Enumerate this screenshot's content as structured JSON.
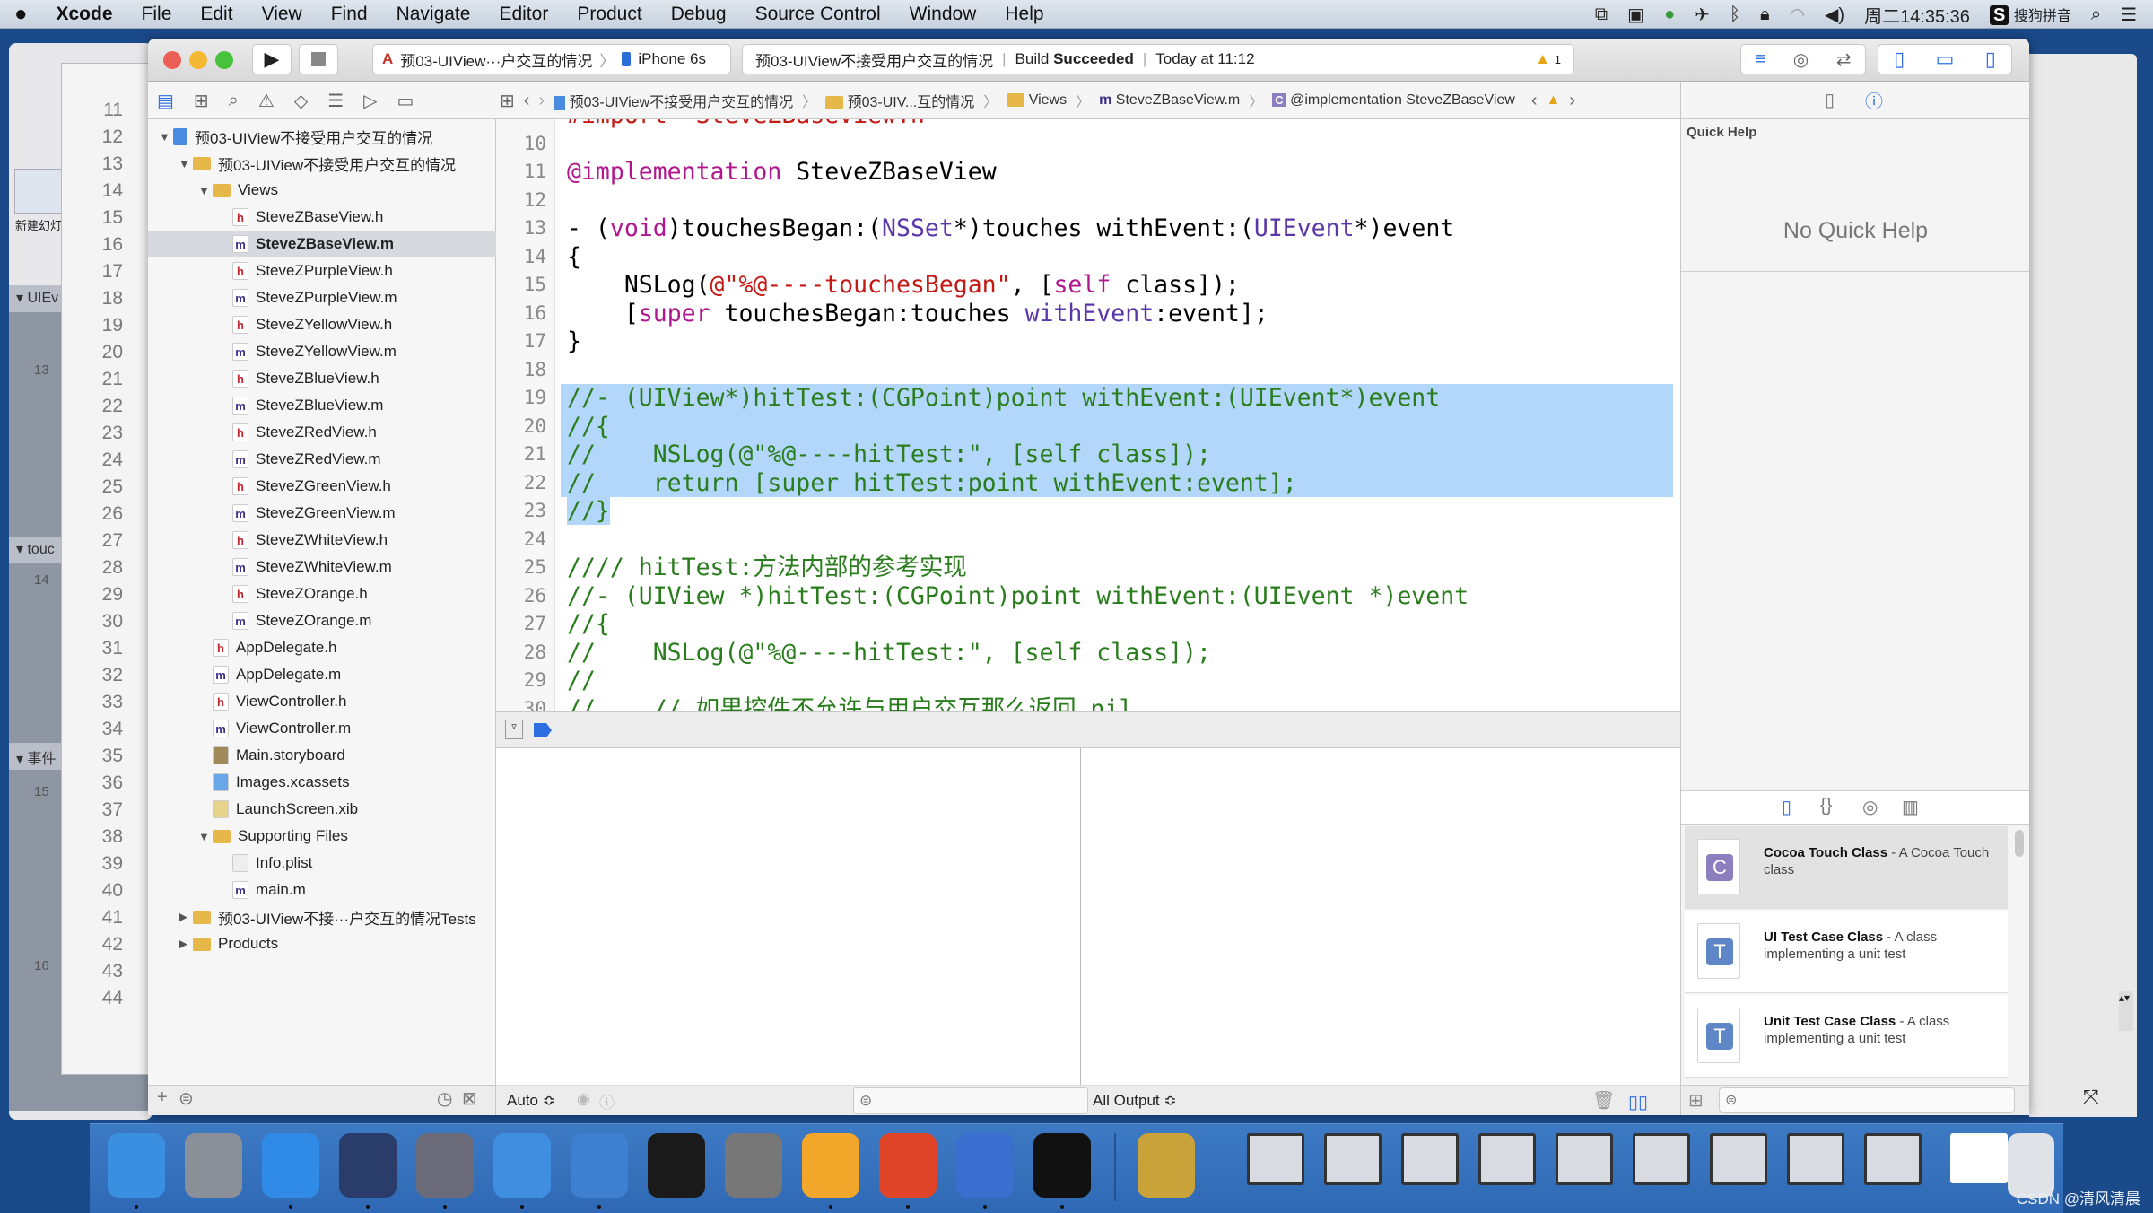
{
  "menubar": {
    "app": "Xcode",
    "items": [
      "File",
      "Edit",
      "View",
      "Find",
      "Navigate",
      "Editor",
      "Product",
      "Debug",
      "Source Control",
      "Window",
      "Help"
    ],
    "clock": "周二14:35:36",
    "input_method": "搜狗拼音"
  },
  "background_app": {
    "button": "新建幻灯片",
    "sections": [
      "UIEv",
      "touc",
      "事件"
    ],
    "slide_numbers": [
      "13",
      "14",
      "15",
      "16"
    ]
  },
  "back_window": {
    "line_numbers": [
      "11",
      "12",
      "13",
      "14",
      "15",
      "16",
      "17",
      "18",
      "19",
      "20",
      "21",
      "22",
      "23",
      "24",
      "25",
      "26",
      "27",
      "28",
      "29",
      "30",
      "31",
      "32",
      "33",
      "34",
      "35",
      "36",
      "37",
      "38",
      "39",
      "40",
      "41",
      "42",
      "43",
      "44"
    ]
  },
  "toolbar": {
    "scheme": "预03-UIView···户交互的情况",
    "device": "iPhone 6s",
    "status_project": "预03-UIView不接受用户交互的情况",
    "status_prefix": "Build",
    "status_result": "Succeeded",
    "status_time": "Today at 11:12",
    "warning_count": "1"
  },
  "jumpbar": {
    "items": [
      "预03-UIView不接受用户交互的情况",
      "预03-UIV...互的情况",
      "Views",
      "SteveZBaseView.m",
      "@implementation SteveZBaseView"
    ]
  },
  "navigator": {
    "items": [
      {
        "label": "预03-UIView不接受用户交互的情况",
        "kind": "project",
        "depth": 0,
        "open": true
      },
      {
        "label": "预03-UIView不接受用户交互的情况",
        "kind": "folder",
        "depth": 1,
        "open": true
      },
      {
        "label": "Views",
        "kind": "folder",
        "depth": 2,
        "open": true
      },
      {
        "label": "SteveZBaseView.h",
        "kind": "h",
        "depth": 3
      },
      {
        "label": "SteveZBaseView.m",
        "kind": "m",
        "depth": 3,
        "selected": true
      },
      {
        "label": "SteveZPurpleView.h",
        "kind": "h",
        "depth": 3
      },
      {
        "label": "SteveZPurpleView.m",
        "kind": "m",
        "depth": 3
      },
      {
        "label": "SteveZYellowView.h",
        "kind": "h",
        "depth": 3
      },
      {
        "label": "SteveZYellowView.m",
        "kind": "m",
        "depth": 3
      },
      {
        "label": "SteveZBlueView.h",
        "kind": "h",
        "depth": 3
      },
      {
        "label": "SteveZBlueView.m",
        "kind": "m",
        "depth": 3
      },
      {
        "label": "SteveZRedView.h",
        "kind": "h",
        "depth": 3
      },
      {
        "label": "SteveZRedView.m",
        "kind": "m",
        "depth": 3
      },
      {
        "label": "SteveZGreenView.h",
        "kind": "h",
        "depth": 3
      },
      {
        "label": "SteveZGreenView.m",
        "kind": "m",
        "depth": 3
      },
      {
        "label": "SteveZWhiteView.h",
        "kind": "h",
        "depth": 3
      },
      {
        "label": "SteveZWhiteView.m",
        "kind": "m",
        "depth": 3
      },
      {
        "label": "SteveZOrange.h",
        "kind": "h",
        "depth": 3
      },
      {
        "label": "SteveZOrange.m",
        "kind": "m",
        "depth": 3
      },
      {
        "label": "AppDelegate.h",
        "kind": "h",
        "depth": 2
      },
      {
        "label": "AppDelegate.m",
        "kind": "m",
        "depth": 2
      },
      {
        "label": "ViewController.h",
        "kind": "h",
        "depth": 2
      },
      {
        "label": "ViewController.m",
        "kind": "m",
        "depth": 2
      },
      {
        "label": "Main.storyboard",
        "kind": "storyboard",
        "depth": 2
      },
      {
        "label": "Images.xcassets",
        "kind": "assets",
        "depth": 2
      },
      {
        "label": "LaunchScreen.xib",
        "kind": "xib",
        "depth": 2
      },
      {
        "label": "Supporting Files",
        "kind": "folder",
        "depth": 2,
        "open": true
      },
      {
        "label": "Info.plist",
        "kind": "plist",
        "depth": 3
      },
      {
        "label": "main.m",
        "kind": "m",
        "depth": 3
      },
      {
        "label": "预03-UIView不接···户交互的情况Tests",
        "kind": "folder",
        "depth": 1,
        "open": false
      },
      {
        "label": "Products",
        "kind": "folder",
        "depth": 1,
        "open": false
      }
    ]
  },
  "editor": {
    "lines": [
      {
        "n": "",
        "tokens": [
          [
            "#import \"SteveZBaseView.h\"",
            "s"
          ]
        ]
      },
      {
        "n": "10",
        "tokens": []
      },
      {
        "n": "11",
        "tokens": [
          [
            "@implementation",
            "k"
          ],
          [
            " SteveZBaseView",
            "p"
          ]
        ]
      },
      {
        "n": "12",
        "tokens": []
      },
      {
        "n": "13",
        "tokens": [
          [
            "- (",
            "p"
          ],
          [
            "void",
            "k"
          ],
          [
            ")touchesBegan:(",
            "p"
          ],
          [
            "NSSet",
            "t"
          ],
          [
            "*)touches withEvent:(",
            "p"
          ],
          [
            "UIEvent",
            "t"
          ],
          [
            "*)event",
            "p"
          ]
        ]
      },
      {
        "n": "14",
        "tokens": [
          [
            "{",
            "p"
          ]
        ]
      },
      {
        "n": "15",
        "tokens": [
          [
            "    NSLog(",
            "p"
          ],
          [
            "@\"%@----touchesBegan\"",
            "s"
          ],
          [
            ", [",
            "p"
          ],
          [
            "self",
            "k"
          ],
          [
            " class]);",
            "p"
          ]
        ]
      },
      {
        "n": "16",
        "tokens": [
          [
            "    [",
            "p"
          ],
          [
            "super",
            "k"
          ],
          [
            " touchesBegan:touches ",
            "p"
          ],
          [
            "withEvent",
            "t"
          ],
          [
            ":event];",
            "p"
          ]
        ]
      },
      {
        "n": "17",
        "tokens": [
          [
            "}",
            "p"
          ]
        ]
      },
      {
        "n": "18",
        "tokens": []
      },
      {
        "n": "19",
        "hl": true,
        "tokens": [
          [
            "//- (UIView*)hitTest:(CGPoint)point withEvent:(UIEvent*)event",
            "g"
          ]
        ]
      },
      {
        "n": "20",
        "hl": true,
        "tokens": [
          [
            "//{",
            "g"
          ]
        ]
      },
      {
        "n": "21",
        "hl": true,
        "tokens": [
          [
            "//    NSLog(@\"%@----hitTest:\", [self class]);",
            "g"
          ]
        ]
      },
      {
        "n": "22",
        "hl": true,
        "tokens": [
          [
            "//    return [super hitTest:point withEvent:event];",
            "g"
          ]
        ]
      },
      {
        "n": "23",
        "hlpart": true,
        "tokens": [
          [
            "//}",
            "g"
          ]
        ]
      },
      {
        "n": "24",
        "tokens": []
      },
      {
        "n": "25",
        "tokens": [
          [
            "//// hitTest:方法内部的参考实现",
            "g"
          ]
        ]
      },
      {
        "n": "26",
        "tokens": [
          [
            "//- (UIView *)hitTest:(CGPoint)point withEvent:(UIEvent *)event",
            "g"
          ]
        ]
      },
      {
        "n": "27",
        "tokens": [
          [
            "//{",
            "g"
          ]
        ]
      },
      {
        "n": "28",
        "tokens": [
          [
            "//    NSLog(@\"%@----hitTest:\", [self class]);",
            "g"
          ]
        ]
      },
      {
        "n": "29",
        "tokens": [
          [
            "//",
            "g"
          ]
        ]
      },
      {
        "n": "30",
        "tokens": [
          [
            "//    // 如果控件不允许与用户交互那么返回 nil",
            "g"
          ]
        ]
      }
    ]
  },
  "debug": {
    "variables_scope": "Auto ≎",
    "console_scope": "All Output ≎"
  },
  "inspector": {
    "title": "Quick Help",
    "empty": "No Quick Help",
    "library": [
      {
        "icon": "C",
        "title": "Cocoa Touch Class",
        "desc": " - A Cocoa Touch class",
        "color": "#8b7fbf",
        "selected": true
      },
      {
        "icon": "T",
        "title": "UI Test Case Class",
        "desc": " - A class implementing a unit test",
        "color": "#5f87c7"
      },
      {
        "icon": "T",
        "title": "Unit Test Case Class",
        "desc": " - A class implementing a unit test",
        "color": "#5f87c7"
      }
    ]
  },
  "dock": {
    "apps": [
      {
        "name": "finder",
        "color": "#3b8fe0"
      },
      {
        "name": "launchpad",
        "color": "#8a8f98"
      },
      {
        "name": "safari",
        "color": "#2f8be6"
      },
      {
        "name": "mouse-app",
        "color": "#2a3d6a"
      },
      {
        "name": "video-app",
        "color": "#6b6b7a"
      },
      {
        "name": "xcode",
        "color": "#3f8ee0"
      },
      {
        "name": "instruments",
        "color": "#3f7fd0"
      },
      {
        "name": "terminal",
        "color": "#1a1a1a"
      },
      {
        "name": "system-preferences",
        "color": "#777"
      },
      {
        "name": "sketch",
        "color": "#f3a72a"
      },
      {
        "name": "wps",
        "color": "#e0452a"
      },
      {
        "name": "remote-app",
        "color": "#3a6fd0"
      },
      {
        "name": "console",
        "color": "#111"
      },
      {
        "name": "media-player",
        "color": "#c9a23a"
      }
    ],
    "minimized_count": 9
  },
  "watermark": "CSDN @清风清晨",
  "colors": {
    "accent": "#2d6fe0",
    "selection": "#b3d6fb",
    "comment": "#2a7d1d",
    "keyword": "#b0178f"
  }
}
